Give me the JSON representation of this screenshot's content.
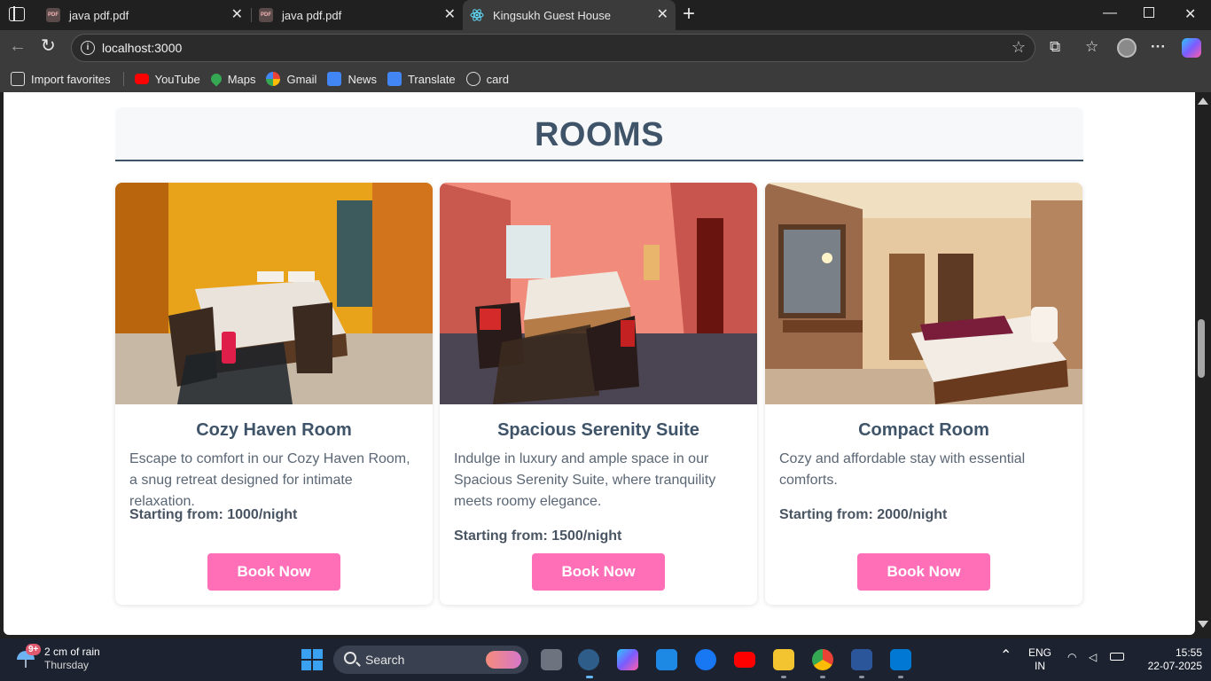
{
  "browser": {
    "tabs": [
      {
        "title": "java pdf.pdf",
        "icon": "pdf-icon",
        "active": false
      },
      {
        "title": "java pdf.pdf",
        "icon": "pdf-icon",
        "active": false
      },
      {
        "title": "Kingsukh Guest House",
        "icon": "react-icon",
        "active": true
      }
    ],
    "url": "localhost:3000",
    "bookmarks": [
      "Import favorites",
      "YouTube",
      "Maps",
      "Gmail",
      "News",
      "Translate",
      "card"
    ]
  },
  "page": {
    "section_title": "ROOMS",
    "rooms": [
      {
        "name": "Cozy Haven Room",
        "description": "Escape to comfort in our Cozy Haven Room, a snug retreat designed for intimate relaxation.",
        "price": "Starting from: 1000/night",
        "button": "Book Now"
      },
      {
        "name": "Spacious Serenity Suite",
        "description": "Indulge in luxury and ample space in our Spacious Serenity Suite, where tranquility meets roomy elegance.",
        "price": "Starting from: 1500/night",
        "button": "Book Now"
      },
      {
        "name": "Compact Room",
        "description": "Cozy and affordable stay with essential comforts.",
        "price": "Starting from: 2000/night",
        "button": "Book Now"
      }
    ]
  },
  "taskbar": {
    "weather_main": "2 cm of rain",
    "weather_day": "Thursday",
    "weather_badge": "9+",
    "search_label": "Search",
    "lang_top": "ENG",
    "lang_bottom": "IN",
    "time": "15:55",
    "date": "22-07-2025"
  },
  "colors": {
    "heading": "#3f5469",
    "button": "#ff6fb8",
    "chrome": "#3b3b3b"
  }
}
